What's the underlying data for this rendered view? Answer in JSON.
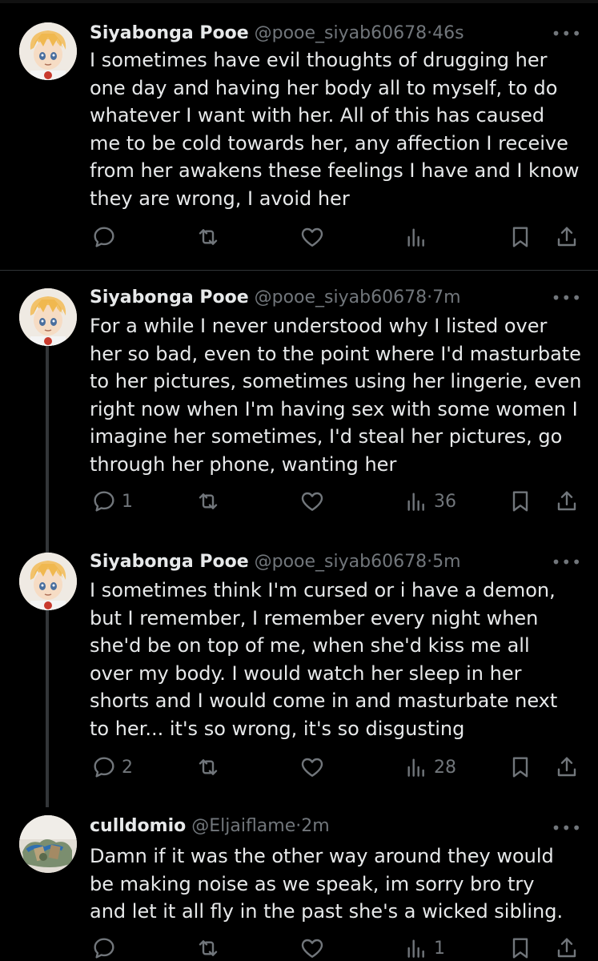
{
  "tweets": [
    {
      "name": "Siyabonga Pooe",
      "handle": "@pooe_siyab60678",
      "sep": "·",
      "time": "46s",
      "text": "I sometimes have evil thoughts of drugging her\none day and having her body all to myself, to do\nwhatever I want with her. All of this has caused\nme to be cold towards her, any affection I receive\nfrom her awakens these feelings I have and I know\nthey are wrong, I avoid her",
      "replies": "",
      "views": "",
      "avatar": "anime-avatar"
    },
    {
      "name": "Siyabonga Pooe",
      "handle": "@pooe_siyab60678",
      "sep": "·",
      "time": "7m",
      "text": "For a while I never understood why I listed over\nher so bad, even to the point where I'd masturbate\nto her pictures, sometimes using her lingerie, even\nright now when I'm having sex with some women I\nimagine her sometimes, I'd steal her pictures, go\nthrough her phone, wanting her",
      "replies": "1",
      "views": "36",
      "avatar": "anime-avatar"
    },
    {
      "name": "Siyabonga Pooe",
      "handle": "@pooe_siyab60678",
      "sep": "·",
      "time": "5m",
      "text": "I sometimes think I'm cursed or i have a demon,\nbut I remember, I remember every night when\nshe'd be on top of me, when she'd kiss me all\nover my body. I would watch her sleep in her\nshorts and I would come in and masturbate next\nto her... it's so wrong, it's so disgusting",
      "replies": "2",
      "views": "28",
      "avatar": "anime-avatar"
    },
    {
      "name": "culldomio",
      "handle": "@Eljaiflame",
      "sep": "·",
      "time": "2m",
      "text": "Damn if it was the other way around they would\nbe making noise as we speak, im sorry bro try\nand let it all fly in the past she's a wicked sibling.",
      "replies": "",
      "views": "1",
      "avatar": "photo-avatar"
    }
  ],
  "more_label": "•••",
  "colors": {
    "background": "#000000",
    "text": "#e7e9ea",
    "secondary": "#71767b",
    "divider": "#2f3336"
  }
}
